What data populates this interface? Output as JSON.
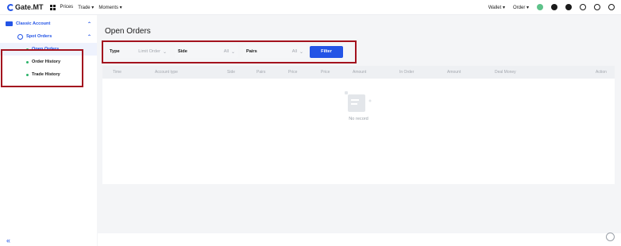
{
  "topbar": {
    "logo": "Gate.MT",
    "nav": [
      "Prices",
      "Trade ▾",
      "Moments ▾"
    ],
    "right": [
      "Wallet ▾",
      "Order ▾"
    ]
  },
  "sidebar": {
    "account": "Classic Account",
    "spot": "Spot Orders",
    "items": [
      "Open Orders",
      "Order History",
      "Trade History"
    ],
    "collapse": "«"
  },
  "main": {
    "title": "Open Orders",
    "filters": {
      "type_label": "Type",
      "type_value": "Limit Order",
      "side_label": "Side",
      "side_value": "All",
      "pairs_label": "Pairs",
      "pairs_value": "All",
      "button": "Filter"
    },
    "table": {
      "columns": [
        "Time",
        "Account type",
        "Side",
        "Pairs",
        "Price",
        "Price",
        "Amount",
        "In Order",
        "Amount",
        "Deal Money",
        "Action"
      ],
      "empty": "No record"
    }
  }
}
